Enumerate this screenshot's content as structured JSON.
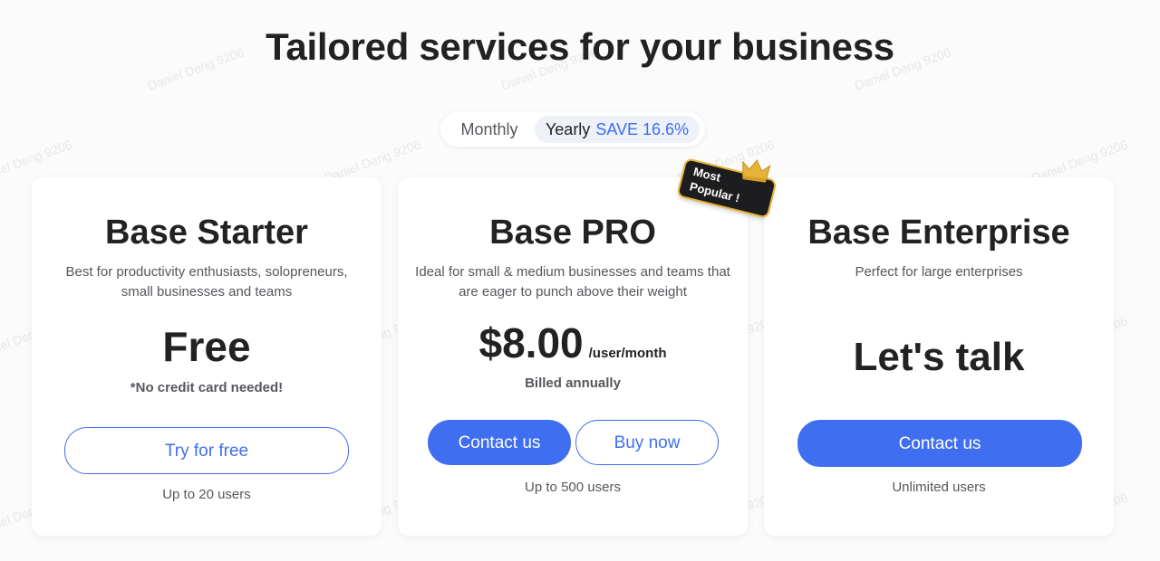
{
  "header": {
    "title": "Tailored services for your business"
  },
  "billing_toggle": {
    "monthly_label": "Monthly",
    "yearly_label": "Yearly",
    "save_label": "SAVE 16.6%",
    "selected": "Yearly"
  },
  "plans": [
    {
      "name": "Base Starter",
      "description": "Best for productivity enthusiasts, solopreneurs, small businesses and teams",
      "price": "Free",
      "price_note": "*No credit card needed!",
      "primary_button": "Try for free",
      "users": "Up to 20 users"
    },
    {
      "name": "Base PRO",
      "description": "Ideal for small & medium businesses and teams that are eager to punch above their weight",
      "price": "$8.00",
      "price_unit": "/user/month",
      "billing": "Billed annually",
      "primary_button": "Contact us",
      "secondary_button": "Buy now",
      "users": "Up to 500 users",
      "badge": "Most Popular !"
    },
    {
      "name": "Base Enterprise",
      "description": "Perfect for large enterprises",
      "price": "Let's talk",
      "primary_button": "Contact us",
      "users": "Unlimited users"
    }
  ],
  "watermark": "Daniel Deng 9206",
  "colors": {
    "accent": "#3f6ff0",
    "text": "#222222",
    "muted": "#55575c",
    "badge_bg": "#1d1d1f",
    "crown": "#e7b23a"
  }
}
